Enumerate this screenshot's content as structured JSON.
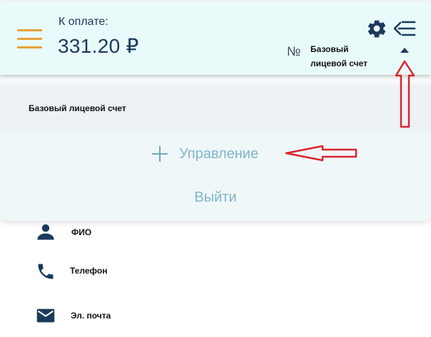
{
  "header": {
    "pay_label": "К оплате:",
    "pay_amount": "331.20",
    "currency": "₽",
    "number_sign": "№",
    "account_name": "Базовый лицевой счет"
  },
  "dropdown": {
    "account_title": "Базовый лицевой счет",
    "manage_label": "Управление",
    "logout_label": "Выйти"
  },
  "profile": {
    "items": [
      {
        "icon": "person-icon",
        "label": "ФИО"
      },
      {
        "icon": "phone-icon",
        "label": "Телефон"
      },
      {
        "icon": "mail-icon",
        "label": "Эл. почта"
      }
    ]
  },
  "colors": {
    "header_bg": "#e9fafb",
    "primary": "#1a3a5c",
    "accent": "#e8a23a",
    "link": "#7fb6c7",
    "annotation": "#d9252b"
  }
}
